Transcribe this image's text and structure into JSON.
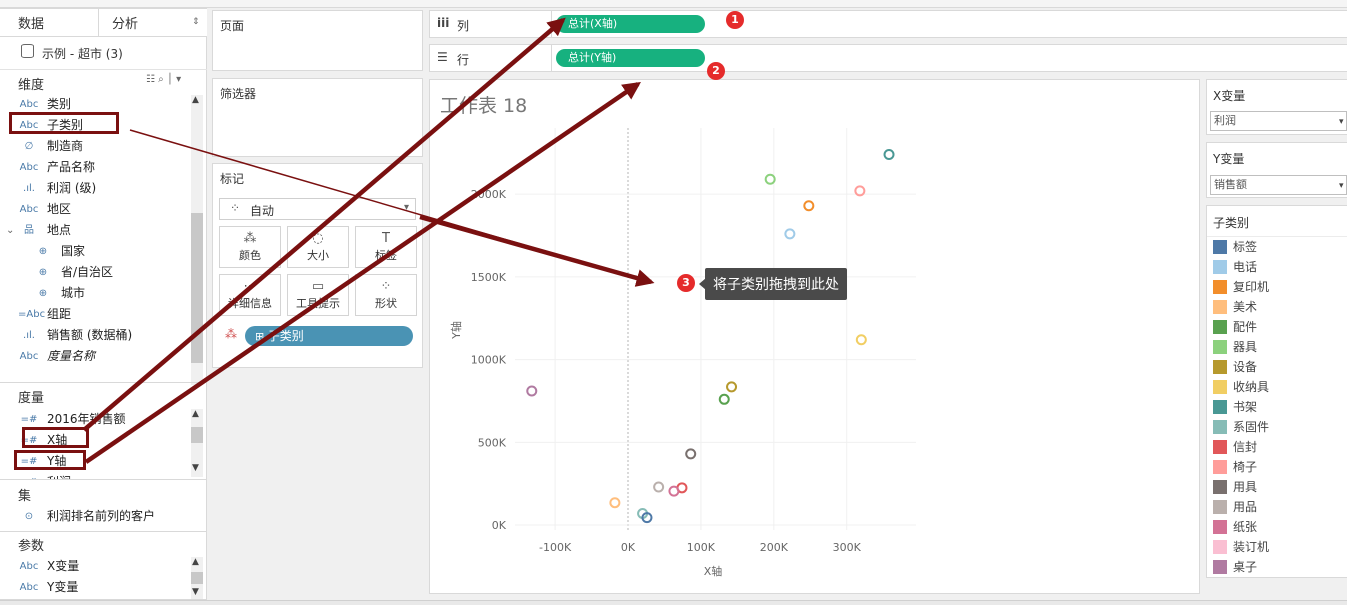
{
  "left": {
    "tabs": [
      {
        "label": "数据"
      },
      {
        "label": "分析"
      }
    ],
    "datasource": "示例 - 超市 (3)",
    "dimensions_title": "维度",
    "dimensions": [
      {
        "icon": "Abc",
        "label": "类别"
      },
      {
        "icon": "Abc",
        "label": "子类别"
      },
      {
        "icon": "∅",
        "label": "制造商"
      },
      {
        "icon": "Abc",
        "label": "产品名称"
      },
      {
        "icon": ".ıl.",
        "label": "利润 (级)"
      },
      {
        "icon": "Abc",
        "label": "地区"
      },
      {
        "icon": "品",
        "label": "地点"
      },
      {
        "icon": "⊕",
        "label": "国家"
      },
      {
        "icon": "⊕",
        "label": "省/自治区"
      },
      {
        "icon": "⊕",
        "label": "城市"
      },
      {
        "icon": "=Abc",
        "label": "组距"
      },
      {
        "icon": ".ıl.",
        "label": "销售额 (数据桶)"
      },
      {
        "icon": "Abc",
        "label": "度量名称"
      }
    ],
    "measures_title": "度量",
    "measures": [
      {
        "icon": "=#",
        "label": "2016年销售额"
      },
      {
        "icon": "=#",
        "label": "X轴"
      },
      {
        "icon": "=#",
        "label": "Y轴"
      },
      {
        "icon": "=#",
        "label": "利润"
      }
    ],
    "sets_title": "集",
    "sets": [
      {
        "icon": "⊙",
        "label": "利润排名前列的客户"
      }
    ],
    "params_title": "参数",
    "params": [
      {
        "icon": "Abc",
        "label": "X变量"
      },
      {
        "icon": "Abc",
        "label": "Y变量"
      }
    ]
  },
  "shelves": {
    "pages": "页面",
    "filters": "筛选器",
    "marks": "标记",
    "mark_type": "自动",
    "cards": [
      {
        "icon": "⁂",
        "label": "颜色"
      },
      {
        "icon": "◌",
        "label": "大小"
      },
      {
        "icon": "T",
        "label": "标签"
      },
      {
        "icon": "⋯",
        "label": "详细信息"
      },
      {
        "icon": "▭",
        "label": "工具提示"
      },
      {
        "icon": "⁘",
        "label": "形状"
      }
    ],
    "color_pill": "子类别",
    "columns_label": "列",
    "rows_label": "行",
    "columns_pill": "总计(X轴)",
    "rows_pill": "总计(Y轴)"
  },
  "annotations": {
    "badges": [
      "1",
      "2",
      "3"
    ],
    "tooltip": "将子类别拖拽到此处"
  },
  "right": {
    "x_var_title": "X变量",
    "x_var_value": "利润",
    "y_var_title": "Y变量",
    "y_var_value": "销售额",
    "legend_title": "子类别",
    "legend": [
      {
        "label": "标签",
        "color": "#4e79a7"
      },
      {
        "label": "电话",
        "color": "#a0cbe8"
      },
      {
        "label": "复印机",
        "color": "#f28e2b"
      },
      {
        "label": "美术",
        "color": "#ffbe7d"
      },
      {
        "label": "配件",
        "color": "#59a14f"
      },
      {
        "label": "器具",
        "color": "#8cd17d"
      },
      {
        "label": "设备",
        "color": "#b6992d"
      },
      {
        "label": "收纳具",
        "color": "#f1ce63"
      },
      {
        "label": "书架",
        "color": "#499894"
      },
      {
        "label": "系固件",
        "color": "#86bcb6"
      },
      {
        "label": "信封",
        "color": "#e15759"
      },
      {
        "label": "椅子",
        "color": "#ff9d9a"
      },
      {
        "label": "用具",
        "color": "#79706e"
      },
      {
        "label": "用品",
        "color": "#bab0ac"
      },
      {
        "label": "纸张",
        "color": "#d37295"
      },
      {
        "label": "装订机",
        "color": "#fabfd2"
      },
      {
        "label": "桌子",
        "color": "#b07aa1"
      }
    ]
  },
  "chart_data": {
    "type": "scatter",
    "title": "工作表 18",
    "xlabel": "X轴",
    "ylabel": "Y轴",
    "xlim": [
      -155000,
      395000
    ],
    "ylim": [
      -30000,
      2400000
    ],
    "x_ticks": [
      -100000,
      0,
      100000,
      200000,
      300000
    ],
    "x_tick_labels": [
      "-100K",
      "0K",
      "100K",
      "200K",
      "300K"
    ],
    "y_ticks": [
      0,
      500000,
      1000000,
      1500000,
      2000000
    ],
    "y_tick_labels": [
      "0K",
      "500K",
      "1000K",
      "1500K",
      "2000K"
    ],
    "grid": true,
    "points": [
      {
        "label": "书架",
        "x": 358000,
        "y": 2240000,
        "color": "#499894"
      },
      {
        "label": "器具",
        "x": 195000,
        "y": 2090000,
        "color": "#8cd17d"
      },
      {
        "label": "椅子",
        "x": 318000,
        "y": 2020000,
        "color": "#ff9d9a"
      },
      {
        "label": "复印机",
        "x": 248000,
        "y": 1930000,
        "color": "#f28e2b"
      },
      {
        "label": "电话",
        "x": 222000,
        "y": 1760000,
        "color": "#a0cbe8"
      },
      {
        "label": "收纳具",
        "x": 320000,
        "y": 1120000,
        "color": "#f1ce63"
      },
      {
        "label": "设备",
        "x": 142000,
        "y": 835000,
        "color": "#b6992d"
      },
      {
        "label": "配件",
        "x": 132000,
        "y": 760000,
        "color": "#59a14f"
      },
      {
        "label": "桌子",
        "x": -132000,
        "y": 810000,
        "color": "#b07aa1"
      },
      {
        "label": "用具",
        "x": 86000,
        "y": 430000,
        "color": "#79706e"
      },
      {
        "label": "用品",
        "x": 42000,
        "y": 230000,
        "color": "#bab0ac"
      },
      {
        "label": "信封",
        "x": 74000,
        "y": 225000,
        "color": "#e15759"
      },
      {
        "label": "纸张",
        "x": 63000,
        "y": 205000,
        "color": "#d37295"
      },
      {
        "label": "美术",
        "x": -18000,
        "y": 135000,
        "color": "#ffbe7d"
      },
      {
        "label": "系固件",
        "x": 20000,
        "y": 70000,
        "color": "#86bcb6"
      },
      {
        "label": "标签",
        "x": 26000,
        "y": 45000,
        "color": "#4e79a7"
      }
    ]
  }
}
